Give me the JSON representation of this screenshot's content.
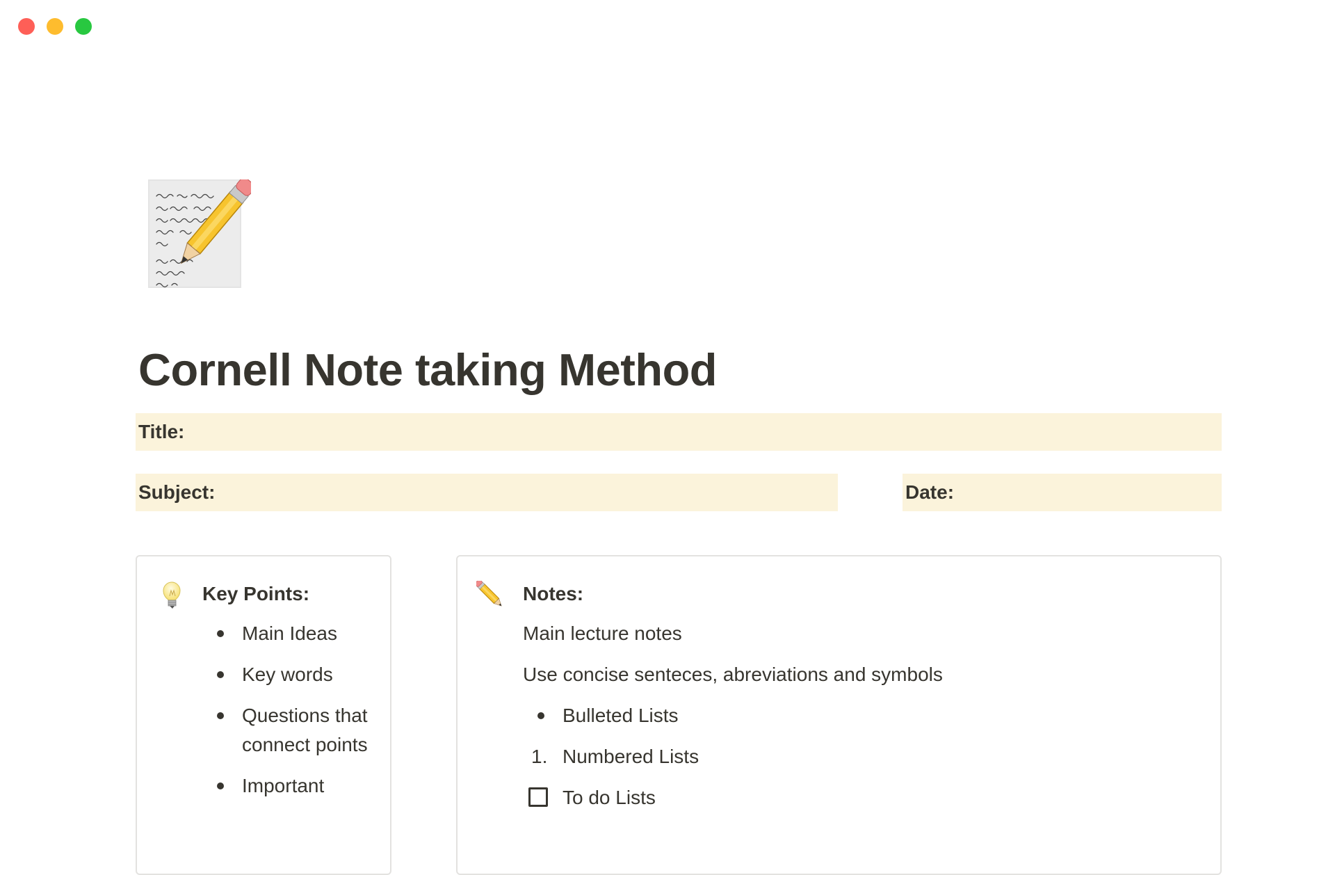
{
  "window": {
    "controls": [
      "close",
      "minimize",
      "zoom"
    ]
  },
  "page": {
    "icon": "memo-icon",
    "title": "Cornell Note taking Method"
  },
  "fields": {
    "title_label": "Title:",
    "subject_label": "Subject:",
    "date_label": "Date:",
    "background_color": "#fbf3db"
  },
  "key_points": {
    "icon": "light-bulb-icon",
    "heading": "Key Points:",
    "items": [
      "Main Ideas",
      "Key words",
      "Questions that connect points",
      "Important"
    ]
  },
  "notes": {
    "icon": "pencil-icon",
    "heading": "Notes:",
    "paragraphs": [
      "Main lecture notes",
      "Use concise senteces, abreviations and symbols"
    ],
    "bulleted_item": "Bulleted Lists",
    "numbered_marker": "1.",
    "numbered_item": "Numbered Lists",
    "todo_item": "To do Lists"
  }
}
